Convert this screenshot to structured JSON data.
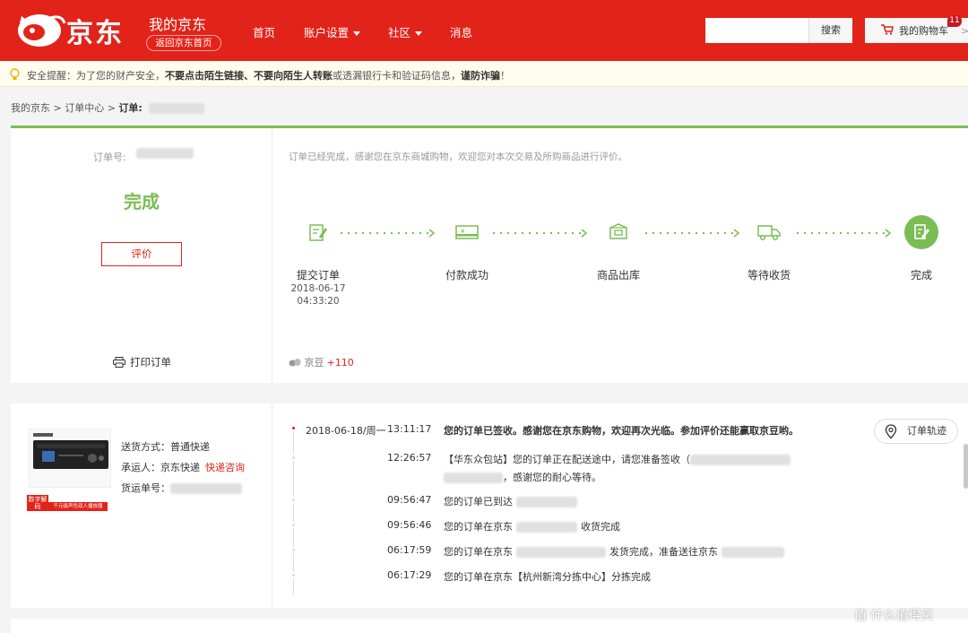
{
  "header": {
    "logo_text": "京东",
    "my_jd": "我的京东",
    "back_home": "返回京东首页",
    "nav": [
      {
        "label": "首页",
        "has_caret": false
      },
      {
        "label": "账户设置",
        "has_caret": true
      },
      {
        "label": "社区",
        "has_caret": true
      },
      {
        "label": "消息",
        "has_caret": false
      }
    ],
    "search_button": "搜索",
    "search_placeholder": "",
    "cart_label": "我的购物车",
    "cart_count": "11",
    "brand_color": "#e2231a"
  },
  "tip": {
    "prefix": "安全提醒：为了您的财产安全，",
    "b1": "不要点击陌生链接、不要向陌生人转账",
    "mid": "或透漏银行卡和验证码信息，",
    "b2": "谨防诈骗",
    "suffix": "！"
  },
  "breadcrumb": {
    "item1": "我的京东",
    "sep": ">",
    "item2": "订单中心",
    "item3": "订单:"
  },
  "order": {
    "order_no_label": "订单号:",
    "status": "完成",
    "review_button": "评价",
    "print_label": "打印订单",
    "message": "订单已经完成，感谢您在京东商城购物，欢迎您对本次交易及所购商品进行评价。",
    "steps": [
      {
        "label": "提交订单",
        "icon": "submit-order-icon"
      },
      {
        "label": "付款成功",
        "icon": "payment-icon"
      },
      {
        "label": "商品出库",
        "icon": "package-icon"
      },
      {
        "label": "等待收货",
        "icon": "truck-icon"
      },
      {
        "label": "完成",
        "icon": "check-done-icon"
      }
    ],
    "submit_date": "2018-06-17",
    "submit_time": "04:33:20",
    "bean_label": "京豆",
    "bean_value": "+110",
    "accent_color": "#7abd54"
  },
  "logistics": {
    "ship_method_label": "送货方式：普通快递",
    "carrier_label": "承运人：京东快递",
    "carrier_link": "快递咨询",
    "tracking_label": "货运单号：",
    "product_badge_text": "数字解码",
    "product_badge_sub": "千元级声色双人播放器",
    "track_button": "订单轨迹",
    "date": "2018-06-18/周一",
    "events": [
      {
        "time": "13:11:17",
        "msg": "您的订单已签收。感谢您在京东购物，欢迎再次光临。参加评价还能赢取京豆哟。",
        "bold": true
      },
      {
        "time": "12:26:57",
        "msg": "【华东众包站】您的订单正在配送途中，请您准备签收（",
        "msg2": "，感谢您的耐心等待。",
        "bold": false
      },
      {
        "time": "09:56:47",
        "msg": "您的订单已到达",
        "bold": false
      },
      {
        "time": "09:56:46",
        "msg": "您的订单在京东",
        "msg_after": "收货完成",
        "bold": false
      },
      {
        "time": "06:17:59",
        "msg": "您的订单在京东",
        "msg_after": "发货完成，准备送往京东",
        "bold": false
      },
      {
        "time": "06:17:29",
        "msg": "您的订单在京东【杭州新湾分拣中心】分拣完成",
        "bold": false
      }
    ]
  },
  "watermark": "值 什么值得买"
}
